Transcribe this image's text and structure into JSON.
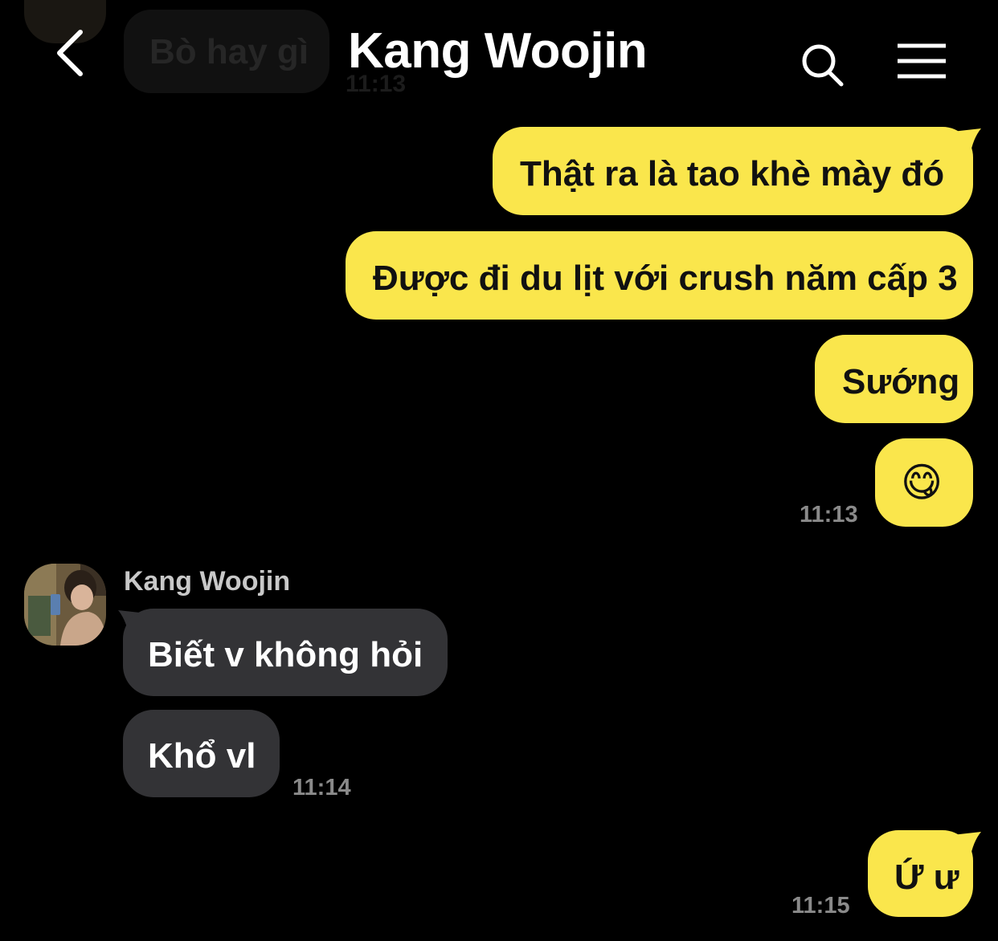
{
  "header": {
    "title": "Kang Woojin"
  },
  "previous_message": {
    "text": "Bò hay gì",
    "time": "11:13"
  },
  "messages": [
    {
      "from": "me",
      "text": "Thật ra là tao khè mày đó"
    },
    {
      "from": "me",
      "text": "Được đi du lịt với crush năm cấp 3"
    },
    {
      "from": "me",
      "text": "Sướng"
    },
    {
      "from": "me",
      "text": "😋",
      "time": "11:13"
    },
    {
      "from": "other",
      "sender": "Kang Woojin",
      "text": "Biết v không hỏi"
    },
    {
      "from": "other",
      "text": "Khổ vl",
      "time": "11:14"
    },
    {
      "from": "me",
      "text": "Ứ ư",
      "time": "11:15"
    }
  ],
  "colors": {
    "my_bubble": "#fae64c",
    "their_bubble": "#333336",
    "background": "#000000"
  },
  "icons": [
    "back-icon",
    "search-icon",
    "menu-icon"
  ]
}
